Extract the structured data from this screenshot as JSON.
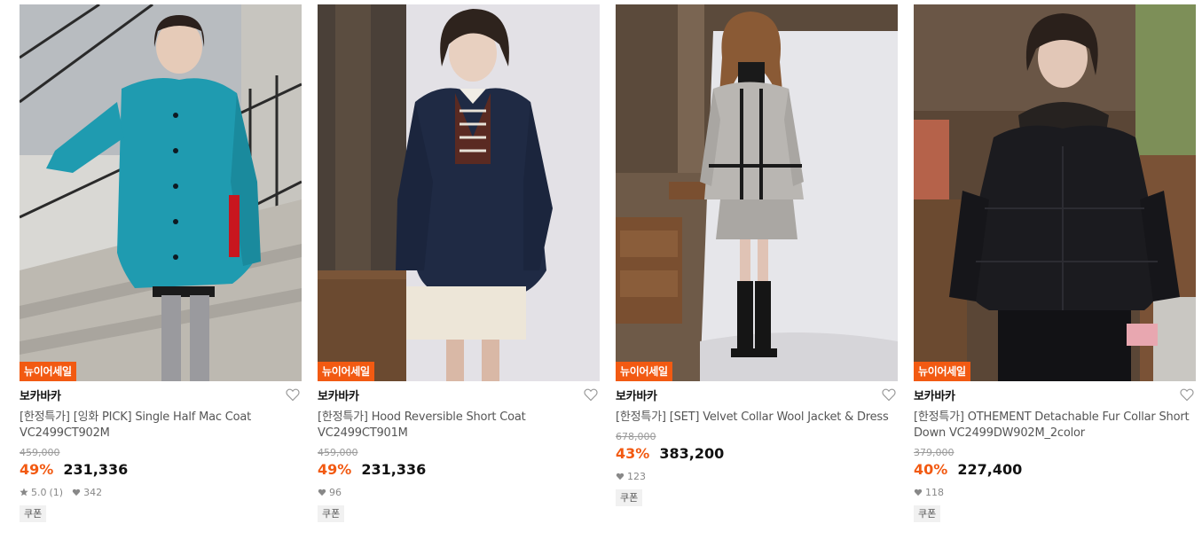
{
  "products": [
    {
      "badge": "뉴이어세일",
      "brand": "보카바카",
      "title": "[한정특가] [잉화 PICK] Single Half Mac Coat VC2499CT902M",
      "original_price": "459,000",
      "discount": "49%",
      "price": "231,336",
      "rating": "5.0",
      "review_count": "(1)",
      "likes": "342",
      "coupon": "쿠폰",
      "coat_color": "#1f9bb0"
    },
    {
      "badge": "뉴이어세일",
      "brand": "보카바카",
      "title": "[한정특가] Hood Reversible Short Coat VC2499CT901M",
      "original_price": "459,000",
      "discount": "49%",
      "price": "231,336",
      "likes": "96",
      "coupon": "쿠폰",
      "coat_color": "#1f2a44"
    },
    {
      "badge": "뉴이어세일",
      "brand": "보카바카",
      "title": "[한정특가] [SET] Velvet Collar Wool Jacket & Dress",
      "original_price": "678,000",
      "discount": "43%",
      "price": "383,200",
      "likes": "123",
      "coupon": "쿠폰",
      "coat_color": "#b9b6b2"
    },
    {
      "badge": "뉴이어세일",
      "brand": "보카바카",
      "title": "[한정특가] OTHEMENT Detachable Fur Collar Short Down VC2499DW902M_2color",
      "original_price": "379,000",
      "discount": "40%",
      "price": "227,400",
      "likes": "118",
      "coupon": "쿠폰",
      "coat_color": "#1b1b1f"
    }
  ],
  "colors": {
    "accent": "#f25a12"
  }
}
